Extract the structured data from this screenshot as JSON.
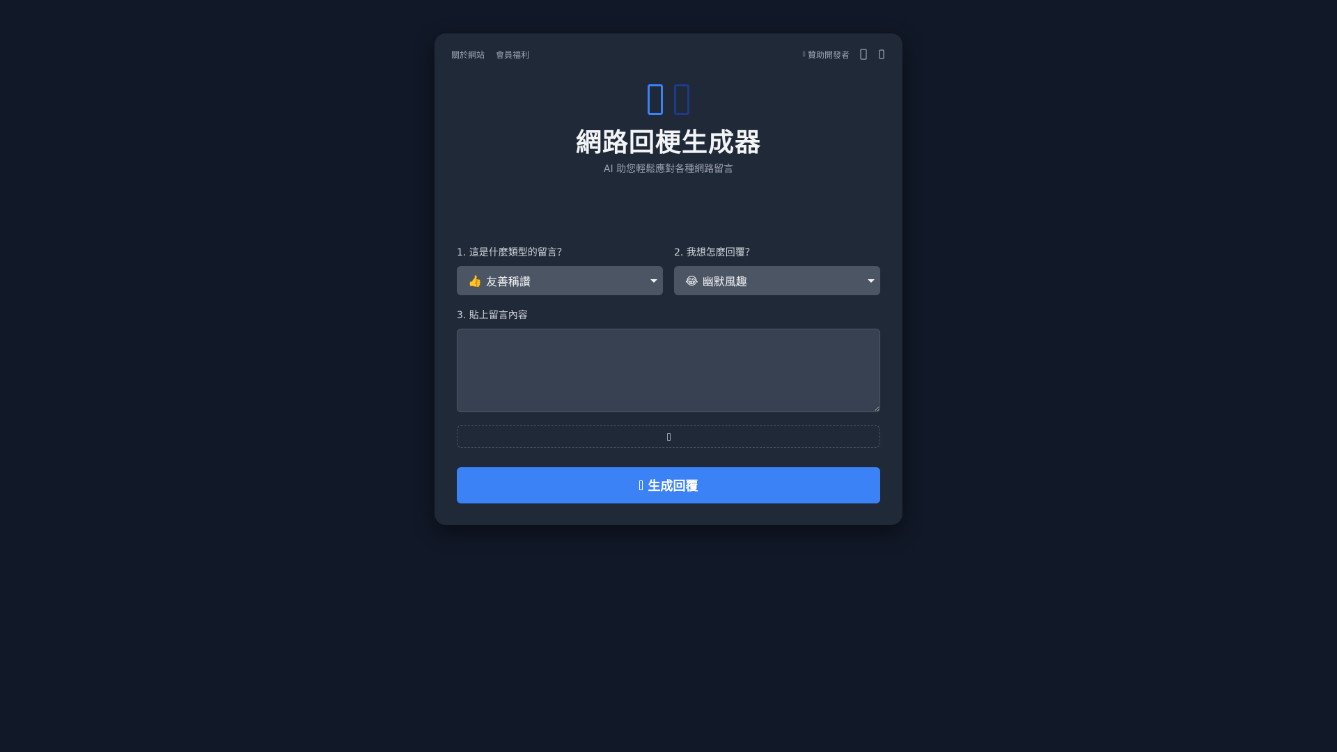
{
  "nav": {
    "about_label": "關於網站",
    "members_label": "會員福利",
    "sponsor_label": "贊助開發者",
    "sponsor_icon": "heart-icon",
    "icon_1": "settings-icon",
    "icon_2": "theme-icon"
  },
  "hero": {
    "icons": [
      "reply-icon",
      "chat-icon"
    ],
    "title": "網路回梗生成器",
    "subtitle": "AI 助您輕鬆應對各種網路留言"
  },
  "form": {
    "comment_type": {
      "label": "1. 這是什麼類型的留言？",
      "selected_emoji": "👍",
      "selected": "友善稱讚"
    },
    "reply_style": {
      "label": "2. 我想怎麼回覆？",
      "selected_emoji": "😂",
      "selected": "幽默風趣"
    },
    "content": {
      "label": "3. 貼上留言內容",
      "value": ""
    },
    "upload_icon": "image-upload-icon",
    "generate_label": "生成回覆",
    "generate_icon": "magic-icon"
  },
  "colors": {
    "background": "#111827",
    "card": "#1f2937",
    "accent": "#3b82f6",
    "select_bg": "#4b5563",
    "textarea_bg": "#374151"
  }
}
